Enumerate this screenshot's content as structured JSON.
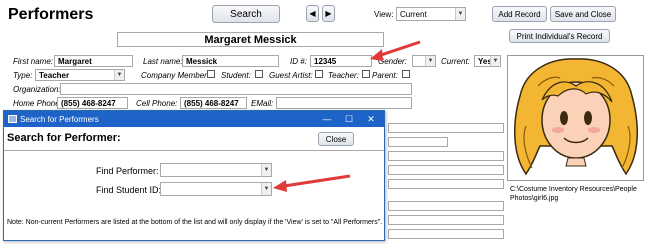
{
  "form": {
    "title": "Performers",
    "search_label": "Search",
    "view_label": "View:",
    "view_value": "Current",
    "add_record_label": "Add Record",
    "save_close_label": "Save and Close",
    "print_label": "Print Individual's Record",
    "name_banner": "Margaret Messick",
    "first_name_label": "First name:",
    "first_name": "Margaret",
    "last_name_label": "Last name:",
    "last_name": "Messick",
    "id_label": "ID #:",
    "id_value": "12345",
    "gender_label": "Gender:",
    "current_label": "Current:",
    "current_value": "Yes",
    "type_label": "Type:",
    "type_value": "Teacher",
    "company_member_label": "Company Member:",
    "student_label": "Student:",
    "guest_artist_label": "Guest Artist:",
    "teacher_label": "Teacher:",
    "parent_label": "Parent:",
    "organization_label": "Organization:",
    "home_phone_label": "Home Phone:",
    "home_phone": "(855) 468-8247",
    "cell_phone_label": "Cell Phone:",
    "cell_phone": "(855) 468-8247",
    "email_label": "EMail:",
    "photo_path": "C:\\Costume Inventory Resources\\People Photos\\girl6.jpg"
  },
  "dialog": {
    "window_title": "Search for Performers",
    "heading": "Search for Performer:",
    "close_label": "Close",
    "find_performer_label": "Find Performer:",
    "find_student_label": "Find Student ID:",
    "note": "Note:  Non-current Performers are listed at the bottom of the list and will only display if the 'View' is set to \"All Performers\"."
  },
  "colors": {
    "title_bar": "#1e63c8",
    "arrow": "#e03a3a",
    "hair": "#f2b632"
  }
}
